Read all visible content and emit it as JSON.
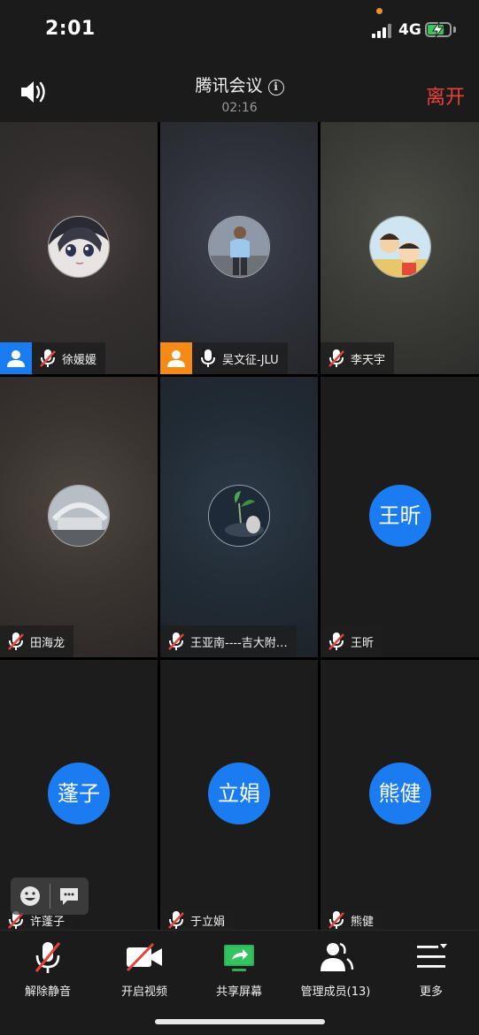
{
  "status_bar": {
    "time": "2:01",
    "network": "4G"
  },
  "header": {
    "title": "腾讯会议",
    "timer": "02:16",
    "leave_label": "离开"
  },
  "participants": [
    {
      "name": "徐媛媛",
      "role_badge": "host-blue",
      "mic": "muted",
      "avatar_type": "image",
      "avatar_desc": "anime-girl"
    },
    {
      "name": "吴文征-JLU",
      "role_badge": "host-orange",
      "mic": "on",
      "avatar_type": "image",
      "avatar_desc": "man-photo"
    },
    {
      "name": "李天宇",
      "role_badge": "",
      "mic": "muted",
      "avatar_type": "image",
      "avatar_desc": "cartoon-family"
    },
    {
      "name": "田海龙",
      "role_badge": "",
      "mic": "muted",
      "avatar_type": "image",
      "avatar_desc": "building-photo"
    },
    {
      "name": "王亚南----吉大附…",
      "role_badge": "",
      "mic": "muted",
      "avatar_type": "image",
      "avatar_desc": "plant-photo"
    },
    {
      "name": "王昕",
      "role_badge": "",
      "mic": "muted",
      "avatar_type": "text",
      "avatar_text": "王昕"
    },
    {
      "name": "许蓬子",
      "role_badge": "",
      "mic": "muted",
      "avatar_type": "text",
      "avatar_text": "蓬子"
    },
    {
      "name": "于立娟",
      "role_badge": "",
      "mic": "muted",
      "avatar_type": "text",
      "avatar_text": "立娟"
    },
    {
      "name": "熊健",
      "role_badge": "",
      "mic": "muted",
      "avatar_type": "text",
      "avatar_text": "熊健"
    }
  ],
  "toolbar": {
    "unmute_label": "解除静音",
    "video_label": "开启视频",
    "share_label": "共享屏幕",
    "members_label": "管理成员(13)",
    "more_label": "更多"
  },
  "colors": {
    "accent": "#1b7bf1",
    "leave": "#e8413a",
    "host_orange": "#f58a16",
    "battery": "#35c759"
  }
}
